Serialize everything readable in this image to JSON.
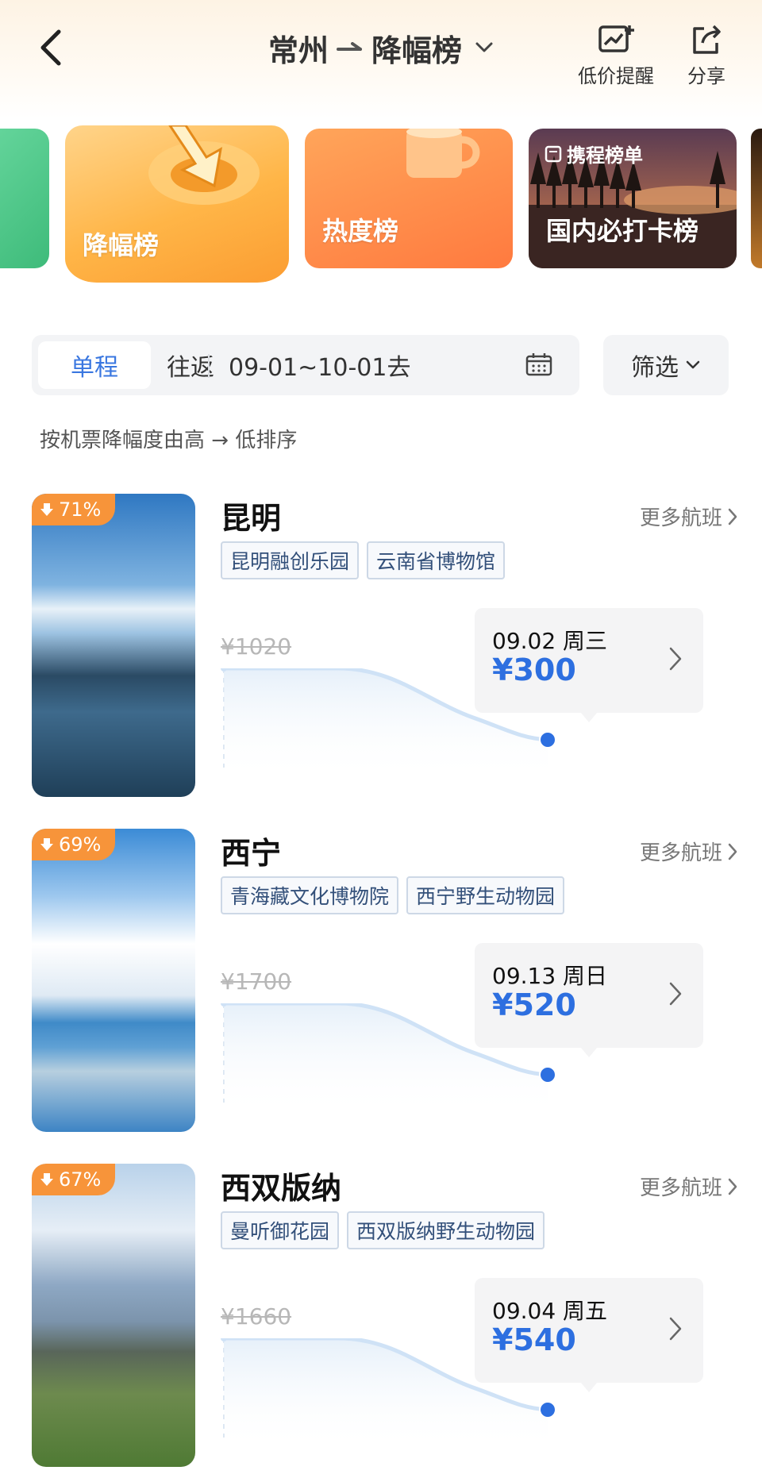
{
  "header": {
    "origin": "常州",
    "rank_title": "降幅榜",
    "alert_label": "低价提醒",
    "share_label": "分享"
  },
  "categories": [
    {
      "label": "降幅榜"
    },
    {
      "label": "热度榜"
    },
    {
      "label": "国内必打卡榜",
      "brand": "携程榜单"
    }
  ],
  "filter": {
    "one_way": "单程",
    "round_trip": "往返",
    "date_range": "09-01~10-01去",
    "filter_label": "筛选"
  },
  "sort_note": "按机票降幅度由高 → 低排序",
  "destinations": [
    {
      "drop": "71%",
      "city": "昆明",
      "more": "更多航班",
      "tags": [
        "昆明融创乐园",
        "云南省博物馆"
      ],
      "old_price": "¥1020",
      "date": "09.02 周三",
      "price": "¥300"
    },
    {
      "drop": "69%",
      "city": "西宁",
      "more": "更多航班",
      "tags": [
        "青海藏文化博物院",
        "西宁野生动物园"
      ],
      "old_price": "¥1700",
      "date": "09.13 周日",
      "price": "¥520"
    },
    {
      "drop": "67%",
      "city": "西双版纳",
      "more": "更多航班",
      "tags": [
        "曼听御花园",
        "西双版纳野生动物园"
      ],
      "old_price": "¥1660",
      "date": "09.04 周五",
      "price": "¥540"
    }
  ],
  "colors": {
    "accent_blue": "#2d6fe0",
    "drop_badge": "#f7943a",
    "curve_line": "#cfe2f6"
  }
}
